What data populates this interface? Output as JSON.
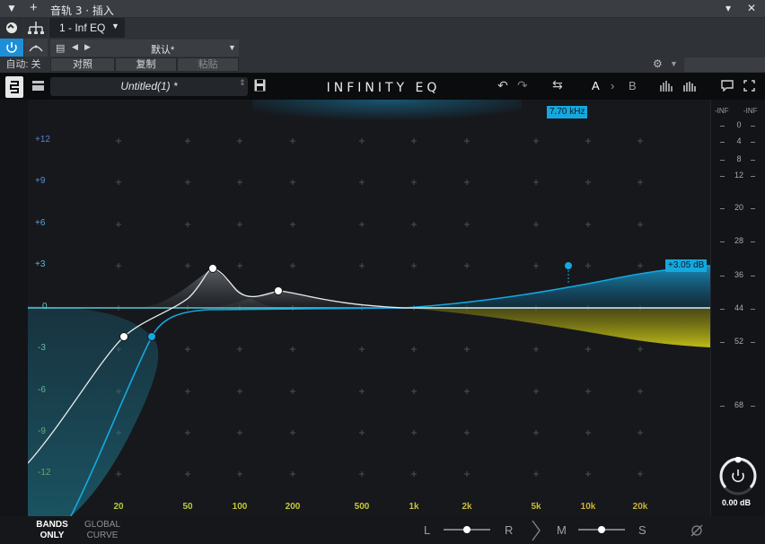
{
  "window": {
    "title": "音轨 3 · 插入",
    "menu_icon": "triangle-down-icon",
    "add_icon": "plus-icon",
    "pin_icon": "pin-icon",
    "close_icon": "close-icon"
  },
  "host": {
    "plugin_slot": "1 - Inf EQ",
    "preset": "默认*",
    "auto_label": "自动: 关",
    "compare_label": "对照",
    "copy_label": "复制",
    "paste_label": "粘贴"
  },
  "plugin": {
    "preset_name": "Untitled(1) *",
    "logo_text": "INFINITY EQ",
    "a_label": "A",
    "b_label": "B"
  },
  "graph": {
    "freq_tooltip": "7.70 kHz",
    "gain_tooltip": "+3.05 dB",
    "db_labels": [
      "+12",
      "+9",
      "+6",
      "+3",
      "0",
      "-3",
      "-6",
      "-9",
      "-12"
    ],
    "freq_labels": [
      "20",
      "50",
      "100",
      "200",
      "500",
      "1k",
      "2k",
      "5k",
      "10k",
      "20k"
    ],
    "colors": {
      "accent_blue": "#14a8e0",
      "yellow": "#c8c21a",
      "white_curve": "#e8ecef"
    }
  },
  "meter": {
    "top_labels": [
      "-INF",
      "-INF"
    ],
    "scale": [
      "0",
      "4",
      "8",
      "12",
      "20",
      "28",
      "36",
      "44",
      "52",
      "68"
    ],
    "output_db": "0.00 dB"
  },
  "bottom": {
    "bands_only": [
      "BANDS",
      "ONLY"
    ],
    "global_curve": [
      "GLOBAL",
      "CURVE"
    ],
    "left": "L",
    "right": "R",
    "mid": "M",
    "side": "S"
  }
}
